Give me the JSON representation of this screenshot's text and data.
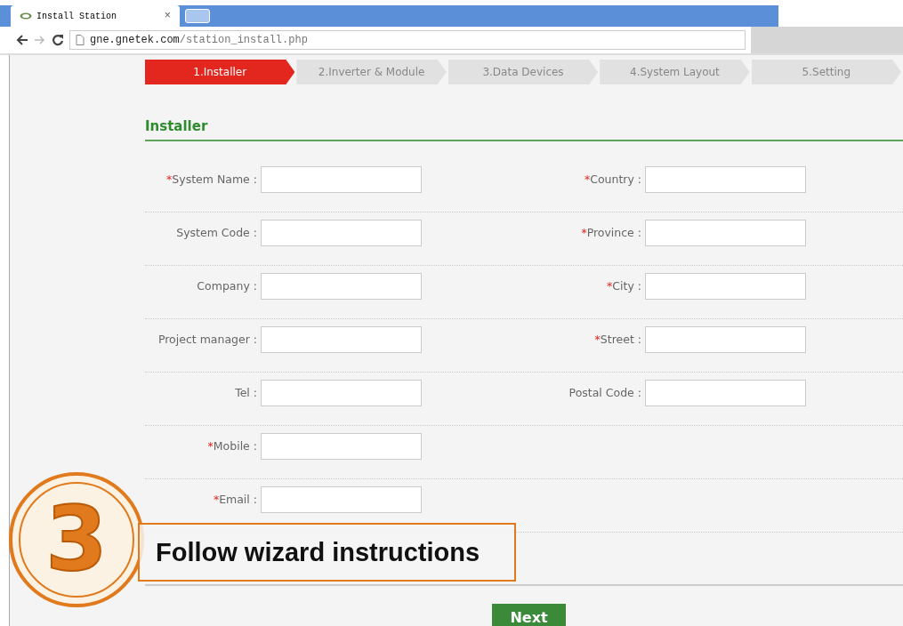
{
  "browser": {
    "tab_title": "Install Station",
    "tab_close": "×",
    "url_host": "gne.gnetek.com",
    "url_path": "/station_install.php"
  },
  "steps": [
    {
      "label": "1.Installer",
      "selected": true
    },
    {
      "label": "2.Inverter & Module",
      "selected": false
    },
    {
      "label": "3.Data Devices",
      "selected": false
    },
    {
      "label": "4.System Layout",
      "selected": false
    },
    {
      "label": "5.Setting",
      "selected": false
    }
  ],
  "section_title": "Installer",
  "rows": [
    {
      "left": {
        "label": "System Name",
        "required": true
      },
      "right": {
        "label": "Country",
        "required": true
      }
    },
    {
      "left": {
        "label": "System Code",
        "required": false
      },
      "right": {
        "label": "Province",
        "required": true
      }
    },
    {
      "left": {
        "label": "Company",
        "required": false
      },
      "right": {
        "label": "City",
        "required": true
      }
    },
    {
      "left": {
        "label": "Project manager",
        "required": false
      },
      "right": {
        "label": "Street",
        "required": true
      }
    },
    {
      "left": {
        "label": "Tel",
        "required": false
      },
      "right": {
        "label": "Postal Code",
        "required": false
      }
    },
    {
      "left": {
        "label": "Mobile",
        "required": true
      }
    },
    {
      "left": {
        "label": "Email",
        "required": true
      }
    }
  ],
  "required_mark": "*",
  "label_separator": ":",
  "callout": {
    "number": "3",
    "text": "Follow wizard instructions"
  },
  "next_button": "Next"
}
